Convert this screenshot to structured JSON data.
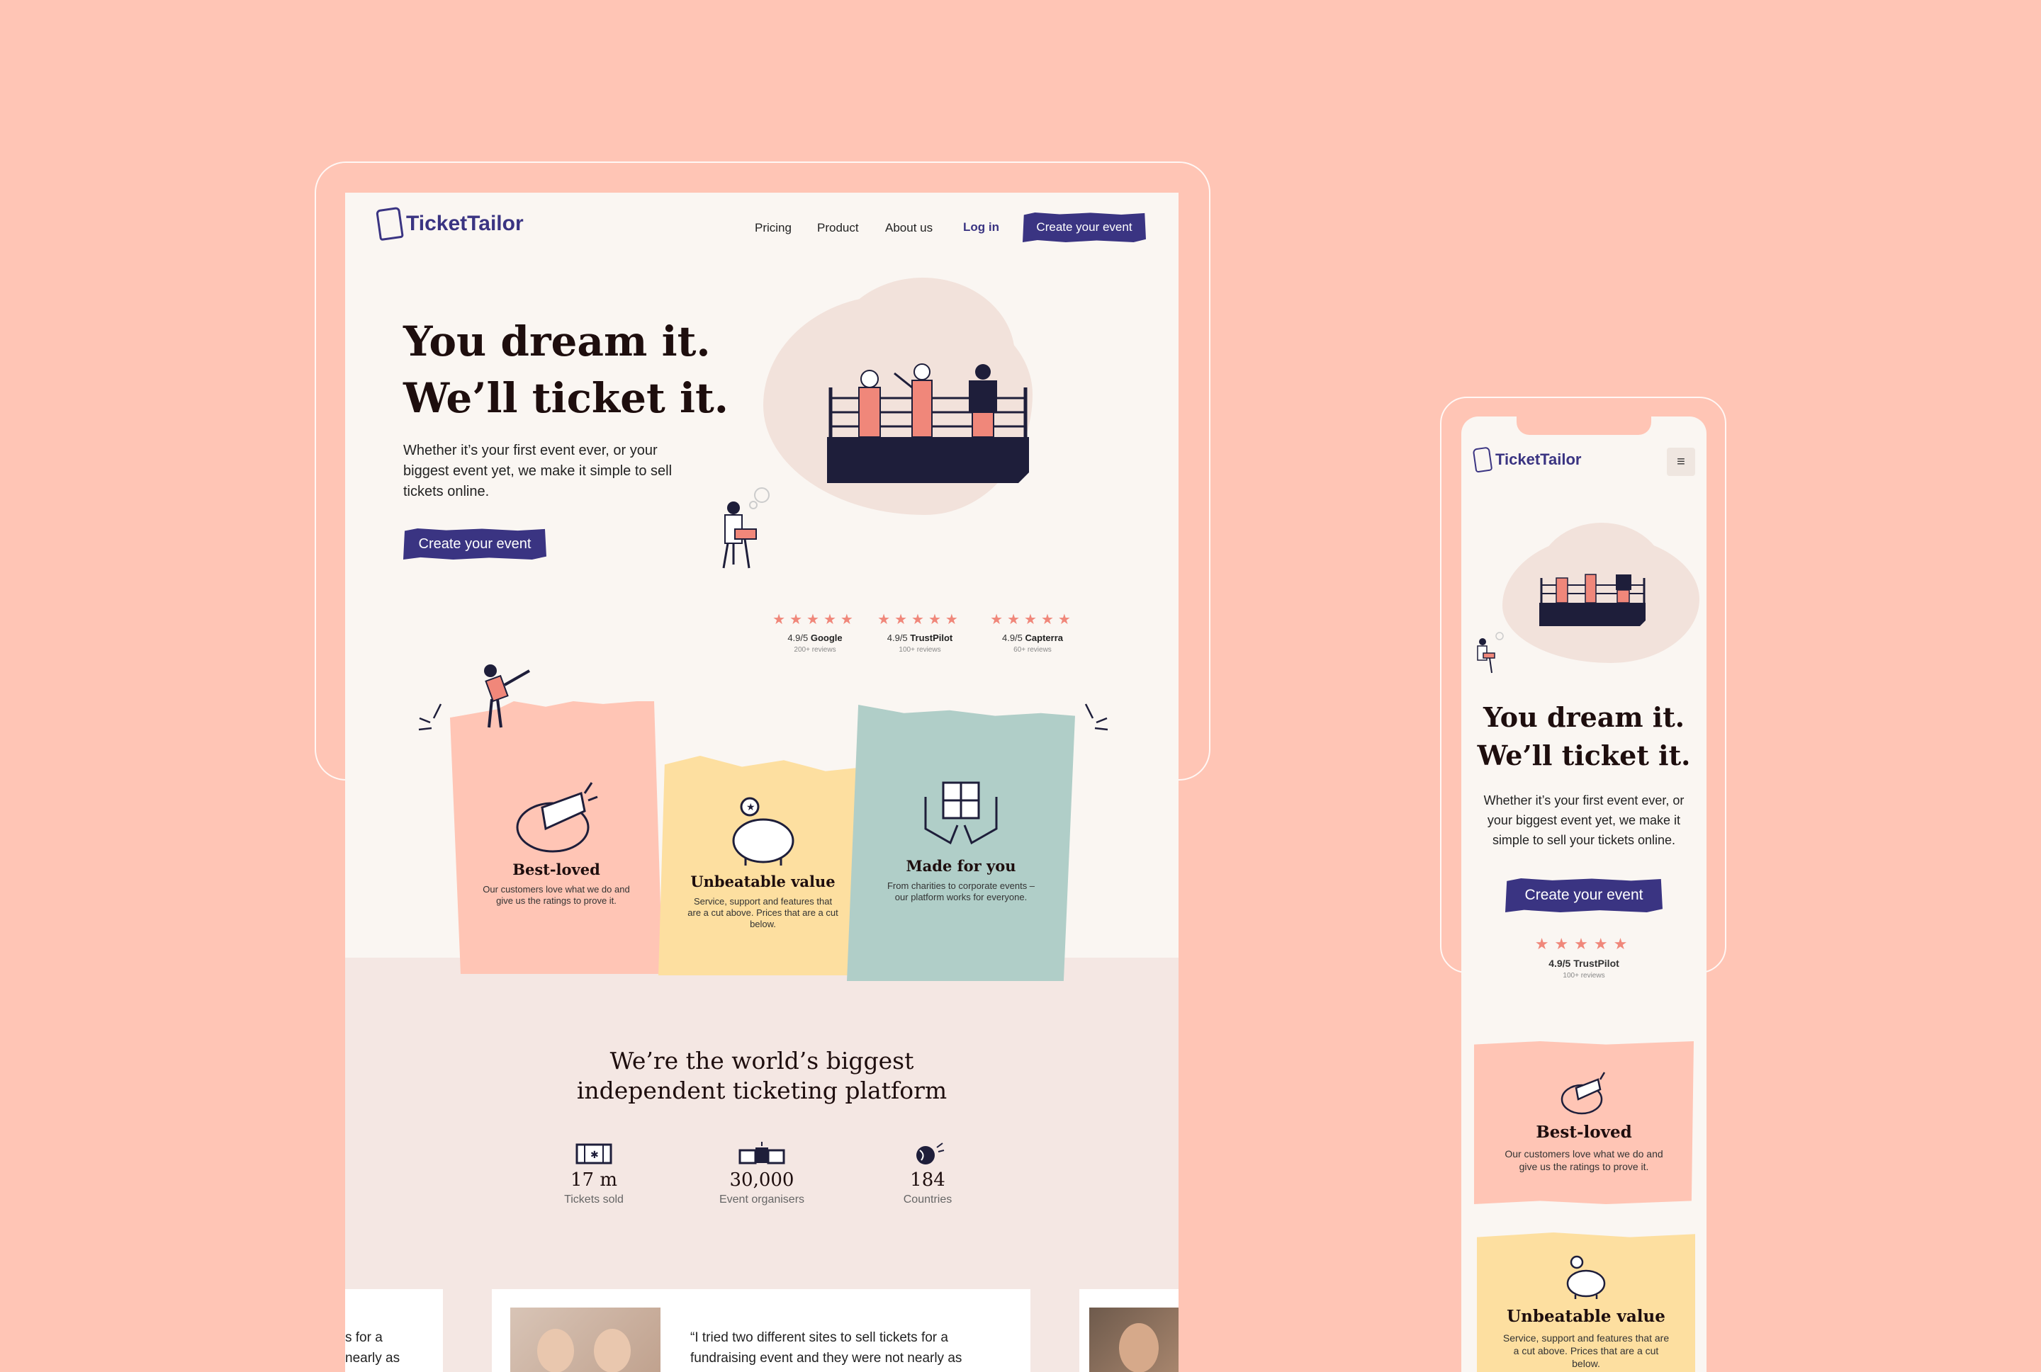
{
  "brand": {
    "name": "TicketTailor",
    "primary_color": "#3A3482",
    "accent_color": "#F0877A",
    "background_color": "#FFC5B5"
  },
  "nav": {
    "links": [
      "Pricing",
      "Product",
      "About us"
    ],
    "login": "Log in",
    "cta": "Create your event"
  },
  "hero": {
    "title_line1": "You dream it.",
    "title_line2": "We’ll ticket it.",
    "subtitle": "Whether it’s your first event ever, or your biggest event yet, we make it simple to sell tickets online.",
    "cta": "Create your event"
  },
  "ratings": [
    {
      "stars": "★★★★★",
      "score": "4.9/5",
      "source": "Google",
      "count": "200+ reviews"
    },
    {
      "stars": "★★★★★",
      "score": "4.9/5",
      "source": "TrustPilot",
      "count": "100+ reviews"
    },
    {
      "stars": "★★★★★",
      "score": "4.9/5",
      "source": "Capterra",
      "count": "60+ reviews"
    }
  ],
  "features": [
    {
      "title": "Best-loved",
      "text": "Our customers love what we do and give us the ratings to prove it.",
      "color": "#FFC5B5",
      "icon": "megaphone-icon"
    },
    {
      "title": "Unbeatable value",
      "text": "Service, support and features that are a cut above. Prices that are a cut below.",
      "color": "#FDDFA0",
      "icon": "piggy-bank-icon"
    },
    {
      "title": "Made for you",
      "text": "From charities to corporate events – our platform works for everyone.",
      "color": "#B0CEC8",
      "icon": "gift-hands-icon"
    }
  ],
  "stats_section": {
    "title_line1": "We’re the world’s biggest",
    "title_line2": "independent ticketing platform",
    "stats": [
      {
        "value": "17 m",
        "label": "Tickets sold",
        "icon": "ticket-icon"
      },
      {
        "value": "30,000",
        "label": "Event organisers",
        "icon": "organisers-icon"
      },
      {
        "value": "184",
        "label": "Countries",
        "icon": "globe-icon"
      }
    ]
  },
  "testimonials": {
    "left_fragment_line1": "s for a",
    "left_fragment_line2": "nearly as",
    "main_line1": "“I tried two different sites to sell tickets for a",
    "main_line2": "fundraising event and they were not nearly as"
  },
  "mobile": {
    "menu_icon": "hamburger-icon",
    "title_line1": "You dream it.",
    "title_line2": "We’ll ticket it.",
    "subtitle": "Whether it’s your first event ever, or your biggest event yet, we make it simple to sell your tickets online.",
    "cta": "Create your event",
    "rating": {
      "stars": "★★★★★",
      "label": "4.9/5 TrustPilot",
      "count": "100+ reviews"
    },
    "features": [
      {
        "title": "Best-loved",
        "text": "Our customers love what we do and give us the ratings to prove it."
      },
      {
        "title": "Unbeatable value",
        "text": "Service, support and features that are a cut above. Prices that are a cut below."
      }
    ]
  }
}
